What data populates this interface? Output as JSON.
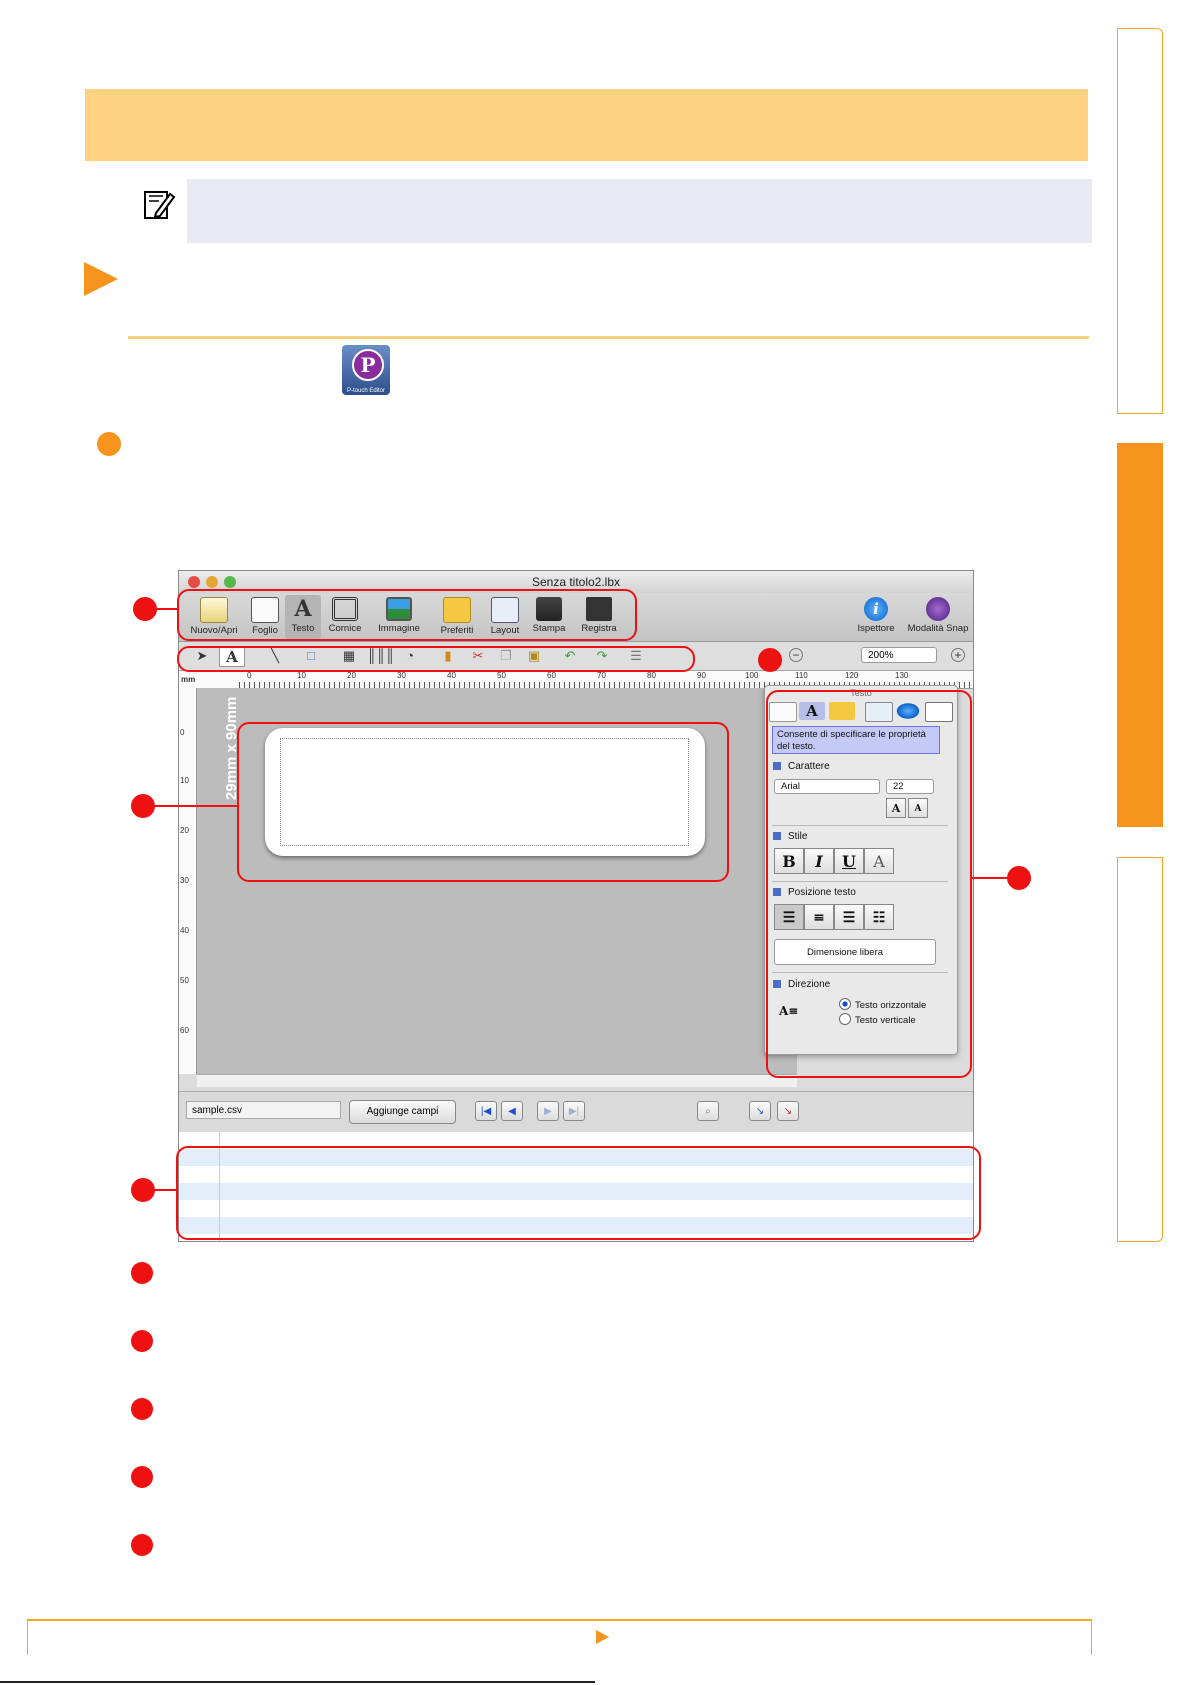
{
  "window": {
    "title": "Senza titolo2.lbx",
    "toolbar": [
      {
        "label": "Nuovo/Apri",
        "icon": "new-open-icon"
      },
      {
        "label": "Foglio",
        "icon": "paper-icon"
      },
      {
        "label": "Testo",
        "icon": "text-icon"
      },
      {
        "label": "Cornice",
        "icon": "frame-icon"
      },
      {
        "label": "Immagine",
        "icon": "image-icon"
      },
      {
        "label": "Preferiti",
        "icon": "favorites-folder-icon"
      },
      {
        "label": "Layout",
        "icon": "layout-icon"
      },
      {
        "label": "Stampa",
        "icon": "print-icon"
      },
      {
        "label": "Registra",
        "icon": "save-disk-icon"
      },
      {
        "label": "Ispettore",
        "icon": "info-icon"
      },
      {
        "label": "Modalità Snap",
        "icon": "snap-icon"
      }
    ],
    "zoom": "200%",
    "ruler_unit": "mm",
    "ruler_h": [
      "0",
      "10",
      "20",
      "30",
      "40",
      "50",
      "60",
      "70",
      "80",
      "90",
      "100",
      "110",
      "120",
      "130"
    ],
    "ruler_v": [
      "0",
      "10",
      "20",
      "30",
      "40",
      "50",
      "60"
    ],
    "label_size": "29mm x 90mm",
    "database": {
      "file": "sample.csv",
      "add_fields": "Aggiunge campi"
    },
    "inspector": {
      "title": "Testo",
      "description": "Consente di specificare le proprietà del testo.",
      "font_section": "Carattere",
      "font_name": "Arial",
      "font_size": "22",
      "style_section": "Stile",
      "style_buttons": [
        "B",
        "I",
        "U",
        "A"
      ],
      "position_section": "Posizione testo",
      "free_size": "Dimensione libera",
      "direction_section": "Direzione",
      "direction_horizontal": "Testo orizzontale",
      "direction_vertical": "Testo verticale",
      "direction_icon": "A≡"
    }
  },
  "colors": {
    "accent_orange": "#f7941d",
    "title_band": "#ffd183",
    "note_band": "#e8e9f3",
    "callout_red": "#ee1111"
  }
}
